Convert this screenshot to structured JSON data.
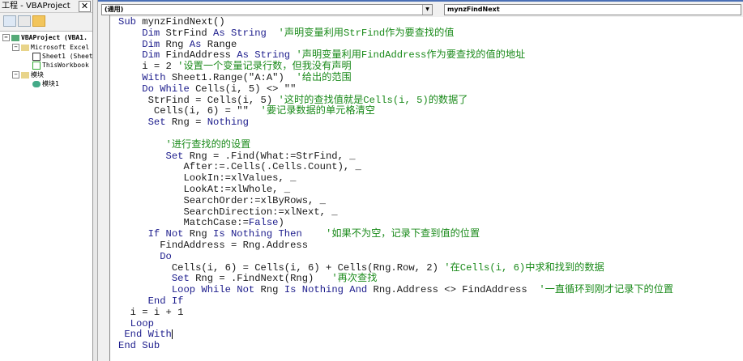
{
  "project": {
    "title": "工程 - VBAProject",
    "close": "✕",
    "tree": [
      {
        "label": "VBAProject (VBA1.",
        "bold": true
      },
      {
        "label": "Microsoft Excel ;"
      },
      {
        "label": "Sheet1 (Sheet"
      },
      {
        "label": "ThisWorkbook"
      },
      {
        "label": "模块"
      },
      {
        "label": "模块1"
      }
    ]
  },
  "combos": {
    "object": "(通用)",
    "procedure": "mynzFindNext"
  },
  "colors": {
    "keyword": "#1c1c8c",
    "comment": "#1a8a1a"
  },
  "code": [
    [
      [
        "k",
        "Sub "
      ],
      [
        "n",
        "mynzFindNext()"
      ]
    ],
    [
      [
        "n",
        "    "
      ],
      [
        "k",
        "Dim "
      ],
      [
        "n",
        "StrFind "
      ],
      [
        "k",
        "As String"
      ],
      [
        "m",
        "  '声明变量利用StrFind作为要查找的值"
      ]
    ],
    [
      [
        "n",
        "    "
      ],
      [
        "k",
        "Dim "
      ],
      [
        "n",
        "Rng "
      ],
      [
        "k",
        "As "
      ],
      [
        "n",
        "Range"
      ]
    ],
    [
      [
        "n",
        "    "
      ],
      [
        "k",
        "Dim "
      ],
      [
        "n",
        "FindAddress "
      ],
      [
        "k",
        "As String"
      ],
      [
        "m",
        " '声明变量利用FindAddress作为要查找的值的地址"
      ]
    ],
    [
      [
        "n",
        "    i = 2 "
      ],
      [
        "m",
        "'设置一个变量记录行数，但我没有声明"
      ]
    ],
    [
      [
        "n",
        "    "
      ],
      [
        "k",
        "With "
      ],
      [
        "n",
        "Sheet1.Range(\"A:A\")  "
      ],
      [
        "m",
        "'给出的范围"
      ]
    ],
    [
      [
        "n",
        "    "
      ],
      [
        "k",
        "Do While "
      ],
      [
        "n",
        "Cells(i, 5) <> \"\""
      ]
    ],
    [
      [
        "n",
        "     StrFind = Cells(i, 5) "
      ],
      [
        "m",
        "'这时的查找值就是Cells(i, 5)的数据了"
      ]
    ],
    [
      [
        "n",
        "      Cells(i, 6) = \"\"  "
      ],
      [
        "m",
        "'要记录数据的单元格清空"
      ]
    ],
    [
      [
        "n",
        "     "
      ],
      [
        "k",
        "Set "
      ],
      [
        "n",
        "Rng = "
      ],
      [
        "k",
        "Nothing"
      ]
    ],
    [
      [
        "n",
        ""
      ]
    ],
    [
      [
        "n",
        "        "
      ],
      [
        "m",
        "'进行查找的的设置"
      ]
    ],
    [
      [
        "n",
        "        "
      ],
      [
        "k",
        "Set "
      ],
      [
        "n",
        "Rng = .Find(What:=StrFind, _"
      ]
    ],
    [
      [
        "n",
        "           After:=.Cells(.Cells.Count), _"
      ]
    ],
    [
      [
        "n",
        "           LookIn:=xlValues, _"
      ]
    ],
    [
      [
        "n",
        "           LookAt:=xlWhole, _"
      ]
    ],
    [
      [
        "n",
        "           SearchOrder:=xlByRows, _"
      ]
    ],
    [
      [
        "n",
        "           SearchDirection:=xlNext, _"
      ]
    ],
    [
      [
        "n",
        "           MatchCase:="
      ],
      [
        "k",
        "False"
      ],
      [
        "n",
        ")"
      ]
    ],
    [
      [
        "n",
        "     "
      ],
      [
        "k",
        "If Not "
      ],
      [
        "n",
        "Rng "
      ],
      [
        "k",
        "Is Nothing Then"
      ],
      [
        "n",
        "    "
      ],
      [
        "m",
        "'如果不为空，记录下查到值的位置"
      ]
    ],
    [
      [
        "n",
        "       FindAddress = Rng.Address"
      ]
    ],
    [
      [
        "n",
        "       "
      ],
      [
        "k",
        "Do"
      ]
    ],
    [
      [
        "n",
        "         Cells(i, 6) = Cells(i, 6) + Cells(Rng.Row, 2) "
      ],
      [
        "m",
        "'在Cells(i, 6)中求和找到的数据"
      ]
    ],
    [
      [
        "n",
        "         "
      ],
      [
        "k",
        "Set "
      ],
      [
        "n",
        "Rng = .FindNext(Rng)   "
      ],
      [
        "m",
        "'再次查找"
      ]
    ],
    [
      [
        "n",
        "         "
      ],
      [
        "k",
        "Loop While Not "
      ],
      [
        "n",
        "Rng "
      ],
      [
        "k",
        "Is Nothing And "
      ],
      [
        "n",
        "Rng.Address <> FindAddress  "
      ],
      [
        "m",
        "'一直循环到刚才记录下的位置"
      ]
    ],
    [
      [
        "n",
        "     "
      ],
      [
        "k",
        "End If"
      ]
    ],
    [
      [
        "n",
        "  i = i + 1"
      ]
    ],
    [
      [
        "n",
        "  "
      ],
      [
        "k",
        "Loop"
      ]
    ],
    [
      [
        "n",
        " "
      ],
      [
        "k",
        "End With"
      ]
    ],
    [
      [
        "k",
        "End Sub"
      ]
    ]
  ]
}
